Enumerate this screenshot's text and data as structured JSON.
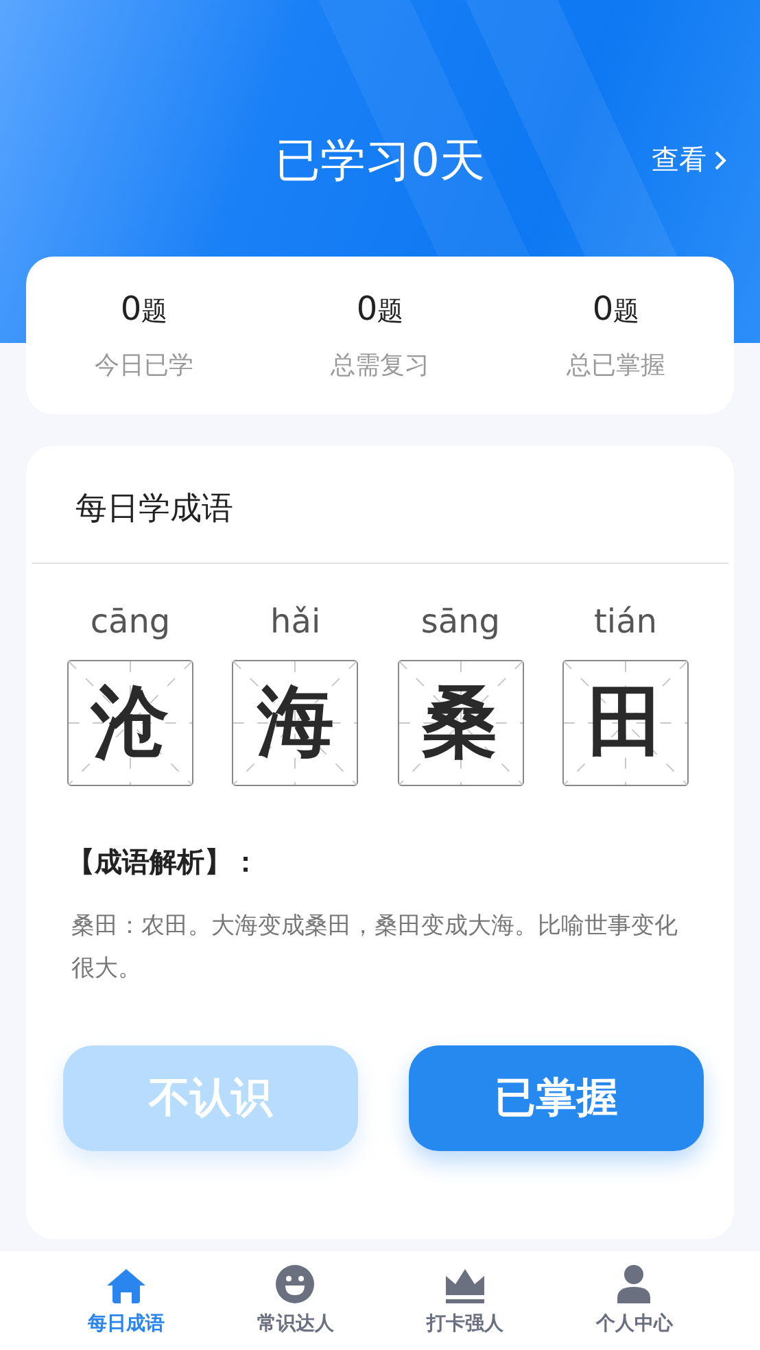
{
  "header": {
    "title": "已学习0天",
    "link": "查看"
  },
  "stats": [
    {
      "value": "0",
      "unit": "题",
      "label": "今日已学"
    },
    {
      "value": "0",
      "unit": "题",
      "label": "总需复习"
    },
    {
      "value": "0",
      "unit": "题",
      "label": "总已掌握"
    }
  ],
  "card": {
    "title": "每日学成语",
    "characters": [
      {
        "pinyin": "cāng",
        "hanzi": "沧"
      },
      {
        "pinyin": "hǎi",
        "hanzi": "海"
      },
      {
        "pinyin": "sāng",
        "hanzi": "桑"
      },
      {
        "pinyin": "tián",
        "hanzi": "田"
      }
    ],
    "analysis_heading": "【成语解析】：",
    "analysis": "桑田：农田。大海变成桑田，桑田变成大海。比喻世事变化很大。",
    "buttons": [
      {
        "label": "不认识",
        "kind": "secondary"
      },
      {
        "label": "已掌握",
        "kind": "primary"
      }
    ]
  },
  "tabs": [
    {
      "label": "每日成语",
      "selected": true
    },
    {
      "label": "常识达人",
      "selected": false
    },
    {
      "label": "打卡强人",
      "selected": false
    },
    {
      "label": "个人中心",
      "selected": false
    }
  ]
}
